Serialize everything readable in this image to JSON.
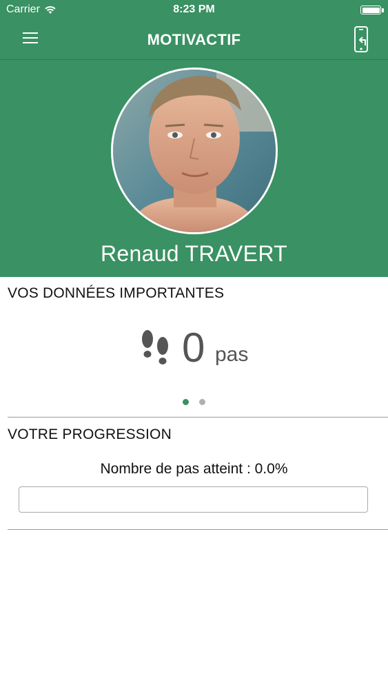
{
  "status_bar": {
    "carrier": "Carrier",
    "time": "8:23 PM",
    "battery_level": 1.0,
    "icons": [
      "wifi-icon",
      "battery-icon"
    ]
  },
  "nav": {
    "title": "MOTIVACTIF",
    "menu_icon": "hamburger-menu-icon",
    "logout_icon": "phone-logout-icon"
  },
  "profile": {
    "name": "Renaud TRAVERT"
  },
  "important_data": {
    "title": "VOS DONNÉES IMPORTANTES",
    "icon": "footprints-icon",
    "steps_value": "0",
    "steps_unit": "pas",
    "page_count": 2,
    "current_page": 1
  },
  "progression": {
    "title": "VOTRE PROGRESSION",
    "label": "Nombre de pas atteint : 0.0%",
    "progress_fraction": 0.0
  },
  "colors": {
    "primary_green": "#3a9163",
    "inactive_dot": "#b0b0b0",
    "text_gray": "#555555"
  }
}
